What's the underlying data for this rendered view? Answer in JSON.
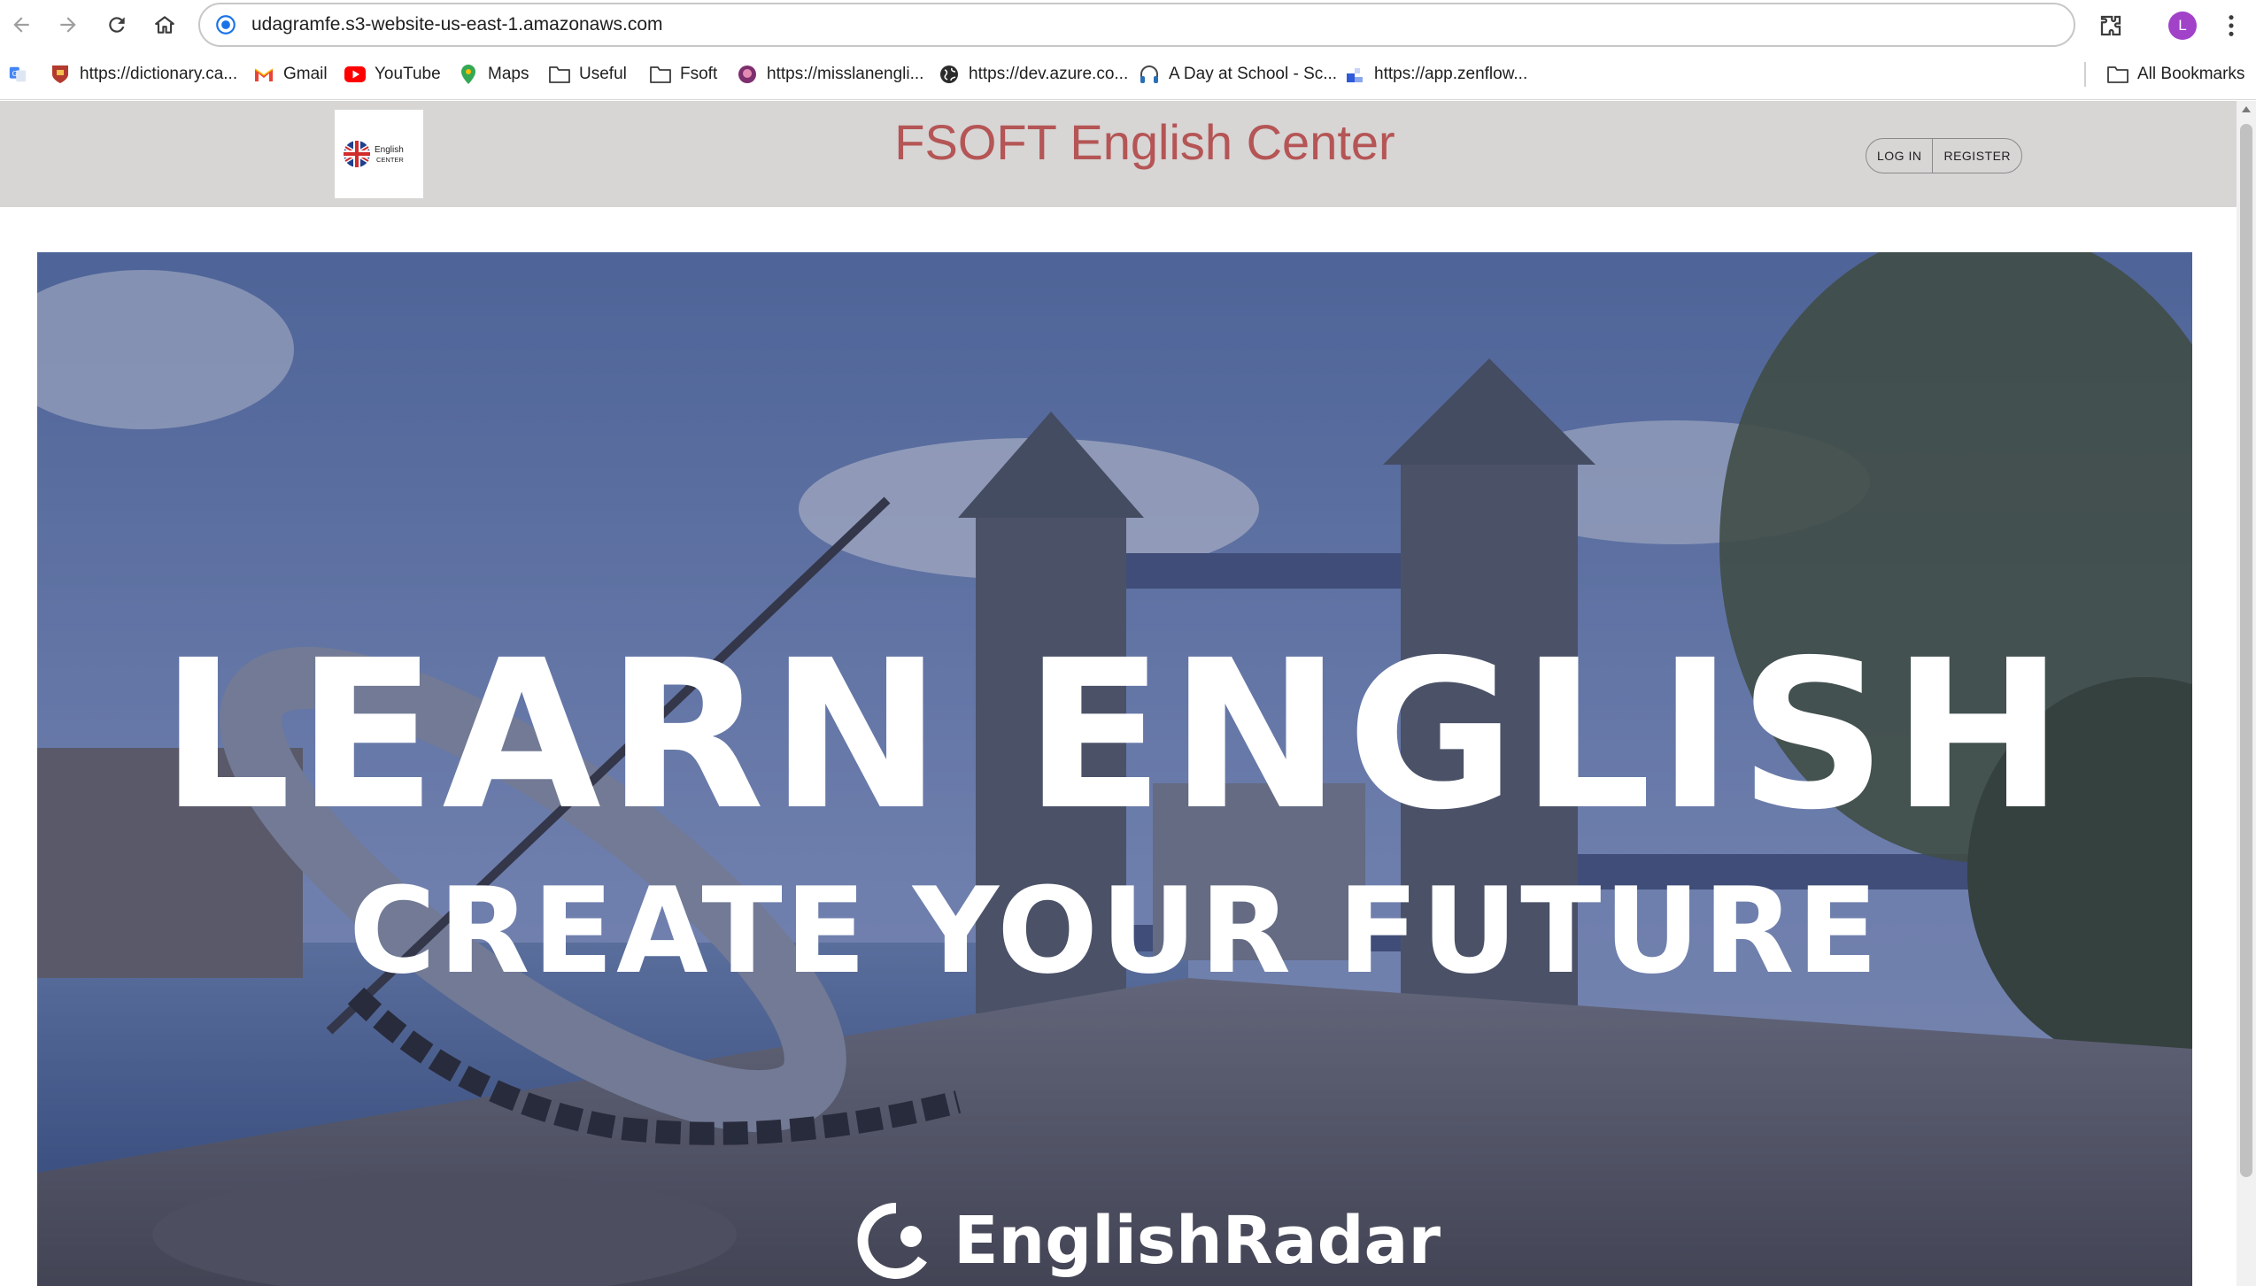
{
  "browser": {
    "url": "udagramfe.s3-website-us-east-1.amazonaws.com",
    "profile_initial": "L",
    "bookmarks": [
      {
        "label": "https://dictionary.ca...",
        "icon": "cambridge-icon"
      },
      {
        "label": "Gmail",
        "icon": "gmail-icon"
      },
      {
        "label": "YouTube",
        "icon": "youtube-icon"
      },
      {
        "label": "Maps",
        "icon": "maps-icon"
      },
      {
        "label": "Useful",
        "icon": "folder-icon"
      },
      {
        "label": "Fsoft",
        "icon": "folder-icon"
      },
      {
        "label": "https://misslanengli...",
        "icon": "site-icon"
      },
      {
        "label": "https://dev.azure.co...",
        "icon": "globe-icon"
      },
      {
        "label": "A Day at School - Sc...",
        "icon": "headphones-icon"
      },
      {
        "label": "https://app.zenflow...",
        "icon": "zenflow-icon"
      }
    ],
    "all_bookmarks": "All Bookmarks"
  },
  "site": {
    "title": "FSOFT English Center",
    "logo_text_line1": "English",
    "logo_text_line2": "CENTER",
    "login": "LOG IN",
    "register": "REGISTER"
  },
  "hero": {
    "title": "LEARN ENGLISH",
    "subtitle": "CREATE YOUR FUTURE",
    "brand": "EnglishRadar"
  },
  "colors": {
    "header_bg": "#d8d5d5",
    "title": "#b55555",
    "avatar": "#a142c9"
  }
}
